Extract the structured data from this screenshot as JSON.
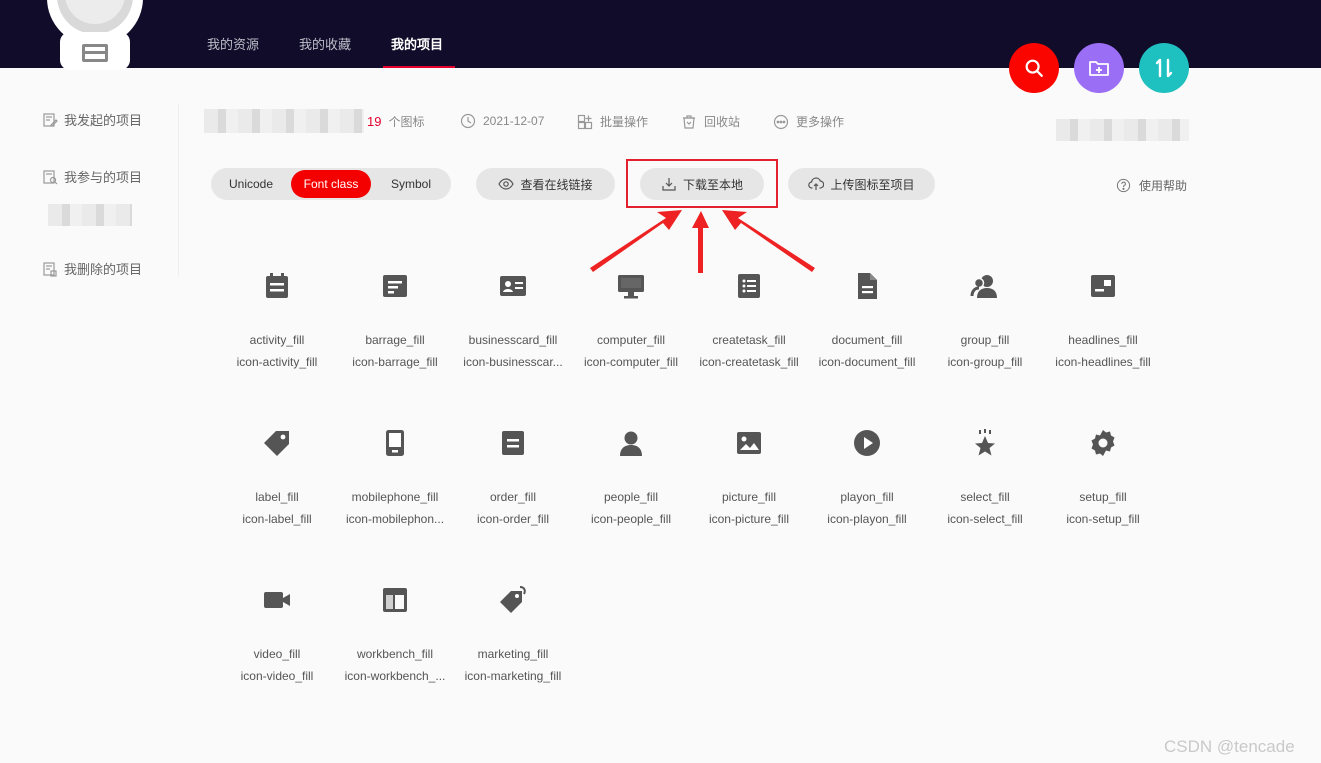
{
  "nav": {
    "items": [
      {
        "label": "我的资源"
      },
      {
        "label": "我的收藏"
      },
      {
        "label": "我的项目",
        "active": true
      }
    ]
  },
  "actions": {
    "search_icon": "search-icon",
    "new_folder_icon": "folder-plus-icon",
    "sort_icon": "sort-icon",
    "colors": {
      "search": "#fa0500",
      "folder": "#9a6ef5",
      "sort": "#1fc0c0"
    }
  },
  "sidebar": {
    "items": [
      {
        "label": "我发起的项目"
      },
      {
        "label": "我参与的项目"
      },
      {
        "label": "我删除的项目"
      }
    ]
  },
  "project": {
    "icon_count": "19",
    "icon_count_label": "个图标",
    "date": "2021-12-07",
    "batch_label": "批量操作",
    "recycle_label": "回收站",
    "more_label": "更多操作"
  },
  "toolbar": {
    "tabs": [
      {
        "label": "Unicode"
      },
      {
        "label": "Font class",
        "active": true
      },
      {
        "label": "Symbol"
      }
    ],
    "view_link_label": "查看在线链接",
    "download_label": "下载至本地",
    "upload_label": "上传图标至项目",
    "help_label": "使用帮助"
  },
  "icons": [
    {
      "name": "activity_fill",
      "cls": "icon-activity_fill",
      "glyph": "calendar-icon"
    },
    {
      "name": "barrage_fill",
      "cls": "icon-barrage_fill",
      "glyph": "barrage-icon"
    },
    {
      "name": "businesscard_fill",
      "cls": "icon-businesscar...",
      "glyph": "business-card-icon"
    },
    {
      "name": "computer_fill",
      "cls": "icon-computer_fill",
      "glyph": "computer-icon"
    },
    {
      "name": "createtask_fill",
      "cls": "icon-createtask_fill",
      "glyph": "task-list-icon"
    },
    {
      "name": "document_fill",
      "cls": "icon-document_fill",
      "glyph": "document-icon"
    },
    {
      "name": "group_fill",
      "cls": "icon-group_fill",
      "glyph": "group-icon"
    },
    {
      "name": "headlines_fill",
      "cls": "icon-headlines_fill",
      "glyph": "headlines-icon"
    },
    {
      "name": "label_fill",
      "cls": "icon-label_fill",
      "glyph": "tag-icon"
    },
    {
      "name": "mobilephone_fill",
      "cls": "icon-mobilephon...",
      "glyph": "mobile-phone-icon"
    },
    {
      "name": "order_fill",
      "cls": "icon-order_fill",
      "glyph": "order-icon"
    },
    {
      "name": "people_fill",
      "cls": "icon-people_fill",
      "glyph": "person-icon"
    },
    {
      "name": "picture_fill",
      "cls": "icon-picture_fill",
      "glyph": "picture-icon"
    },
    {
      "name": "playon_fill",
      "cls": "icon-playon_fill",
      "glyph": "play-icon"
    },
    {
      "name": "select_fill",
      "cls": "icon-select_fill",
      "glyph": "star-select-icon"
    },
    {
      "name": "setup_fill",
      "cls": "icon-setup_fill",
      "glyph": "gear-icon"
    },
    {
      "name": "video_fill",
      "cls": "icon-video_fill",
      "glyph": "video-camera-icon"
    },
    {
      "name": "workbench_fill",
      "cls": "icon-workbench_...",
      "glyph": "workbench-icon"
    },
    {
      "name": "marketing_fill",
      "cls": "icon-marketing_fill",
      "glyph": "marketing-tag-icon"
    }
  ],
  "watermark": "CSDN @tencade",
  "accent": "#e5002e"
}
